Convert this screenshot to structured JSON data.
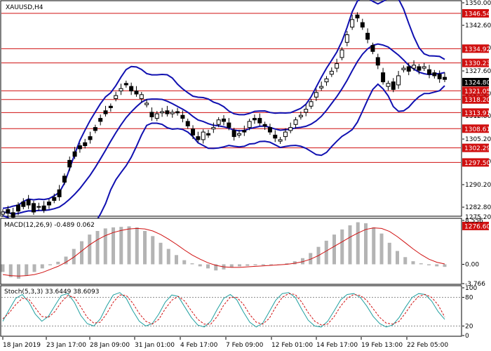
{
  "chart_data": {
    "type": "candlestick",
    "symbol_label": "XAUUSD,H4",
    "price_axis": {
      "ylim": [
        1275.2,
        1350.0
      ],
      "ticks": [
        "1350.00",
        "1342.60",
        "1335.20",
        "1327.60",
        "1320.20",
        "1312.80",
        "1305.20",
        "1297.80",
        "1290.20",
        "1282.80",
        "1275.20"
      ]
    },
    "current_price": "1324.80",
    "levels": [
      {
        "label": "1346.54",
        "value": 1346.54
      },
      {
        "label": "1334.92",
        "value": 1334.92
      },
      {
        "label": "1330.23",
        "value": 1330.23
      },
      {
        "label": "1321.05",
        "value": 1321.05
      },
      {
        "label": "1318.20",
        "value": 1318.2
      },
      {
        "label": "1313.91",
        "value": 1313.91
      },
      {
        "label": "1308.61",
        "value": 1308.61
      },
      {
        "label": "1302.29",
        "value": 1302.29
      },
      {
        "label": "1297.50",
        "value": 1297.5
      },
      {
        "label": "1276.60",
        "value": 1276.6
      }
    ],
    "x_labels": [
      "18 Jan 2019",
      "23 Jan 17:00",
      "28 Jan 09:00",
      "31 Jan 01:00",
      "4 Feb 17:00",
      "7 Feb 09:00",
      "12 Feb 01:00",
      "14 Feb 17:00",
      "19 Feb 13:00",
      "22 Feb 05:00"
    ],
    "close_path": [
      [
        1280.5,
        1281.2
      ],
      [
        1282.0,
        1280.8
      ],
      [
        1281.0,
        1279.5
      ],
      [
        1283.5,
        1281.5
      ],
      [
        1284.5,
        1283.0
      ],
      [
        1285.2,
        1283.5
      ],
      [
        1284.0,
        1281.2
      ],
      [
        1282.8,
        1283.0
      ],
      [
        1283.2,
        1281.8
      ],
      [
        1284.5,
        1283.5
      ],
      [
        1286.0,
        1285.0
      ],
      [
        1288.5,
        1286.2
      ],
      [
        1293.0,
        1291.0
      ],
      [
        1298.2,
        1296.0
      ],
      [
        1301.0,
        1299.5
      ],
      [
        1303.0,
        1302.0
      ],
      [
        1304.0,
        1303.0
      ],
      [
        1306.0,
        1305.0
      ],
      [
        1309.0,
        1308.0
      ],
      [
        1312.0,
        1311.0
      ],
      [
        1314.5,
        1313.5
      ],
      [
        1316.0,
        1315.5
      ],
      [
        1318.5,
        1319.5
      ],
      [
        1321.0,
        1321.8
      ],
      [
        1323.5,
        1323.0
      ],
      [
        1322.5,
        1321.0
      ],
      [
        1321.0,
        1320.0
      ],
      [
        1318.5,
        1319.8
      ],
      [
        1316.5,
        1317.0
      ],
      [
        1314.0,
        1312.5
      ],
      [
        1312.0,
        1313.5
      ],
      [
        1313.8,
        1314.2
      ],
      [
        1314.5,
        1313.5
      ],
      [
        1313.5,
        1314.0
      ],
      [
        1314.2,
        1313.8
      ],
      [
        1313.0,
        1312.0
      ],
      [
        1311.0,
        1309.5
      ],
      [
        1308.5,
        1306.5
      ],
      [
        1306.0,
        1305.0
      ],
      [
        1305.0,
        1307.5
      ],
      [
        1307.0,
        1306.5
      ],
      [
        1308.5,
        1309.0
      ],
      [
        1310.0,
        1311.5
      ],
      [
        1311.8,
        1311.0
      ],
      [
        1310.5,
        1309.0
      ],
      [
        1308.0,
        1306.0
      ],
      [
        1306.5,
        1307.0
      ],
      [
        1308.0,
        1307.5
      ],
      [
        1309.0,
        1311.0
      ],
      [
        1312.0,
        1311.5
      ],
      [
        1312.0,
        1310.5
      ],
      [
        1310.0,
        1309.5
      ],
      [
        1309.0,
        1307.5
      ],
      [
        1306.5,
        1305.5
      ],
      [
        1304.5,
        1305.0
      ],
      [
        1306.0,
        1307.5
      ],
      [
        1308.0,
        1309.0
      ],
      [
        1310.0,
        1311.5
      ],
      [
        1312.5,
        1313.0
      ],
      [
        1314.0,
        1315.0
      ],
      [
        1316.0,
        1317.5
      ],
      [
        1319.0,
        1320.5
      ],
      [
        1322.0,
        1322.5
      ],
      [
        1324.0,
        1325.0
      ],
      [
        1326.5,
        1327.5
      ],
      [
        1328.5,
        1330.0
      ],
      [
        1332.0,
        1334.5
      ],
      [
        1337.0,
        1339.5
      ],
      [
        1342.0,
        1344.5
      ],
      [
        1346.0,
        1345.0
      ],
      [
        1343.5,
        1342.0
      ],
      [
        1340.0,
        1338.0
      ],
      [
        1336.0,
        1334.0
      ],
      [
        1332.0,
        1329.5
      ],
      [
        1327.0,
        1324.0
      ],
      [
        1322.5,
        1323.5
      ],
      [
        1324.0,
        1321.5
      ],
      [
        1323.0,
        1326.0
      ],
      [
        1328.0,
        1328.5
      ],
      [
        1329.0,
        1327.5
      ],
      [
        1328.5,
        1329.5
      ],
      [
        1329.0,
        1327.8
      ],
      [
        1328.5,
        1329.0
      ],
      [
        1328.0,
        1326.5
      ],
      [
        1327.0,
        1326.0
      ],
      [
        1326.5,
        1325.0
      ],
      [
        1325.5,
        1324.8
      ]
    ],
    "macd": {
      "label": "MACD(12,26,9) -0.489 0.062",
      "ylim": [
        -3.766,
        8.556
      ],
      "ticks": [
        "8.556",
        "0.00",
        "-3.766"
      ],
      "hist_path": [
        -1.5,
        -2.5,
        -2.8,
        -2.2,
        -1.5,
        -0.8,
        -0.2,
        0.5,
        1.5,
        3.0,
        4.5,
        5.8,
        6.5,
        7.0,
        7.2,
        7.3,
        7.4,
        7.2,
        6.5,
        5.5,
        4.2,
        3.0,
        1.8,
        0.8,
        0.2,
        -0.4,
        -0.8,
        -1.2,
        -1.0,
        -0.6,
        -0.4,
        -0.3,
        -0.2,
        -0.2,
        -0.1,
        0.0,
        0.2,
        0.6,
        1.2,
        2.2,
        3.4,
        4.6,
        5.8,
        6.8,
        7.6,
        8.2,
        8.0,
        7.2,
        6.0,
        4.2,
        2.6,
        1.4,
        0.6,
        0.2,
        -0.2,
        -0.4,
        -0.5
      ],
      "signal_path": [
        -2.0,
        -2.2,
        -2.3,
        -2.2,
        -2.0,
        -1.6,
        -1.0,
        -0.4,
        0.4,
        1.4,
        2.6,
        3.8,
        4.8,
        5.6,
        6.2,
        6.6,
        6.9,
        7.0,
        6.9,
        6.5,
        5.8,
        4.9,
        3.9,
        2.8,
        1.8,
        1.0,
        0.3,
        -0.2,
        -0.5,
        -0.6,
        -0.6,
        -0.5,
        -0.4,
        -0.3,
        -0.2,
        -0.1,
        0.0,
        0.2,
        0.5,
        1.0,
        1.7,
        2.6,
        3.5,
        4.4,
        5.3,
        6.1,
        6.8,
        7.1,
        7.0,
        6.4,
        5.4,
        4.2,
        3.0,
        1.9,
        1.0,
        0.4,
        0.062
      ]
    },
    "stochastic": {
      "label": "Stoch(5,3,3) 33.6449 38.6093",
      "ylim": [
        0,
        100
      ],
      "ticks": [
        "100",
        "80",
        "20",
        "0"
      ],
      "k_path": [
        30,
        55,
        78,
        86,
        70,
        45,
        30,
        40,
        62,
        84,
        88,
        70,
        42,
        25,
        20,
        35,
        62,
        85,
        90,
        78,
        52,
        30,
        20,
        25,
        45,
        70,
        85,
        82,
        60,
        38,
        22,
        18,
        30,
        55,
        78,
        86,
        75,
        50,
        28,
        18,
        26,
        50,
        74,
        88,
        90,
        80,
        55,
        32,
        20,
        18,
        30,
        52,
        75,
        86,
        88,
        80,
        62,
        40,
        25,
        18,
        22,
        38,
        60,
        80,
        88,
        86,
        72,
        50,
        34
      ],
      "d_path": [
        35,
        48,
        65,
        78,
        76,
        58,
        40,
        38,
        50,
        70,
        84,
        80,
        60,
        38,
        26,
        28,
        46,
        70,
        85,
        84,
        68,
        46,
        30,
        24,
        34,
        56,
        74,
        82,
        72,
        52,
        34,
        24,
        24,
        40,
        64,
        80,
        80,
        66,
        44,
        28,
        24,
        36,
        60,
        80,
        88,
        86,
        70,
        48,
        30,
        22,
        24,
        40,
        62,
        78,
        86,
        84,
        74,
        56,
        38,
        26,
        24,
        30,
        48,
        68,
        82,
        86,
        80,
        64,
        39
      ]
    }
  }
}
